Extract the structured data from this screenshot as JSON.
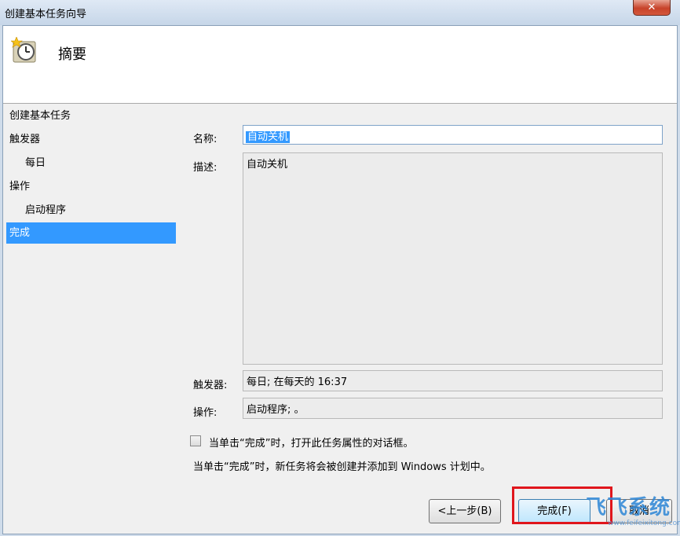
{
  "window": {
    "title": "创建基本任务向导",
    "close_label": "✕"
  },
  "header": {
    "title": "摘要",
    "icon": "clock-icon"
  },
  "nav": {
    "items": [
      {
        "label": "创建基本任务"
      },
      {
        "label": "触发器"
      },
      {
        "label": "每日"
      },
      {
        "label": "操作"
      },
      {
        "label": "启动程序"
      },
      {
        "label": "完成"
      }
    ]
  },
  "form": {
    "name_label": "名称:",
    "name_value": "自动关机",
    "desc_label": "描述:",
    "desc_value": "自动关机",
    "trigger_label": "触发器:",
    "trigger_value": "每日; 在每天的 16:37",
    "action_label": "操作:",
    "action_value": "启动程序; 。",
    "open_props_label": "当单击“完成”时，打开此任务属性的对话框。",
    "info_text": "当单击“完成”时，新任务将会被创建并添加到 Windows 计划中。"
  },
  "buttons": {
    "back_label": "<上一步(B)",
    "finish_label": "完成(F)",
    "cancel_label": "取消"
  },
  "watermark": {
    "brand": "飞飞系统",
    "url": "www.feifeixitong.com"
  },
  "colors": {
    "accent": "#3399ff",
    "highlight": "#e0161c"
  }
}
